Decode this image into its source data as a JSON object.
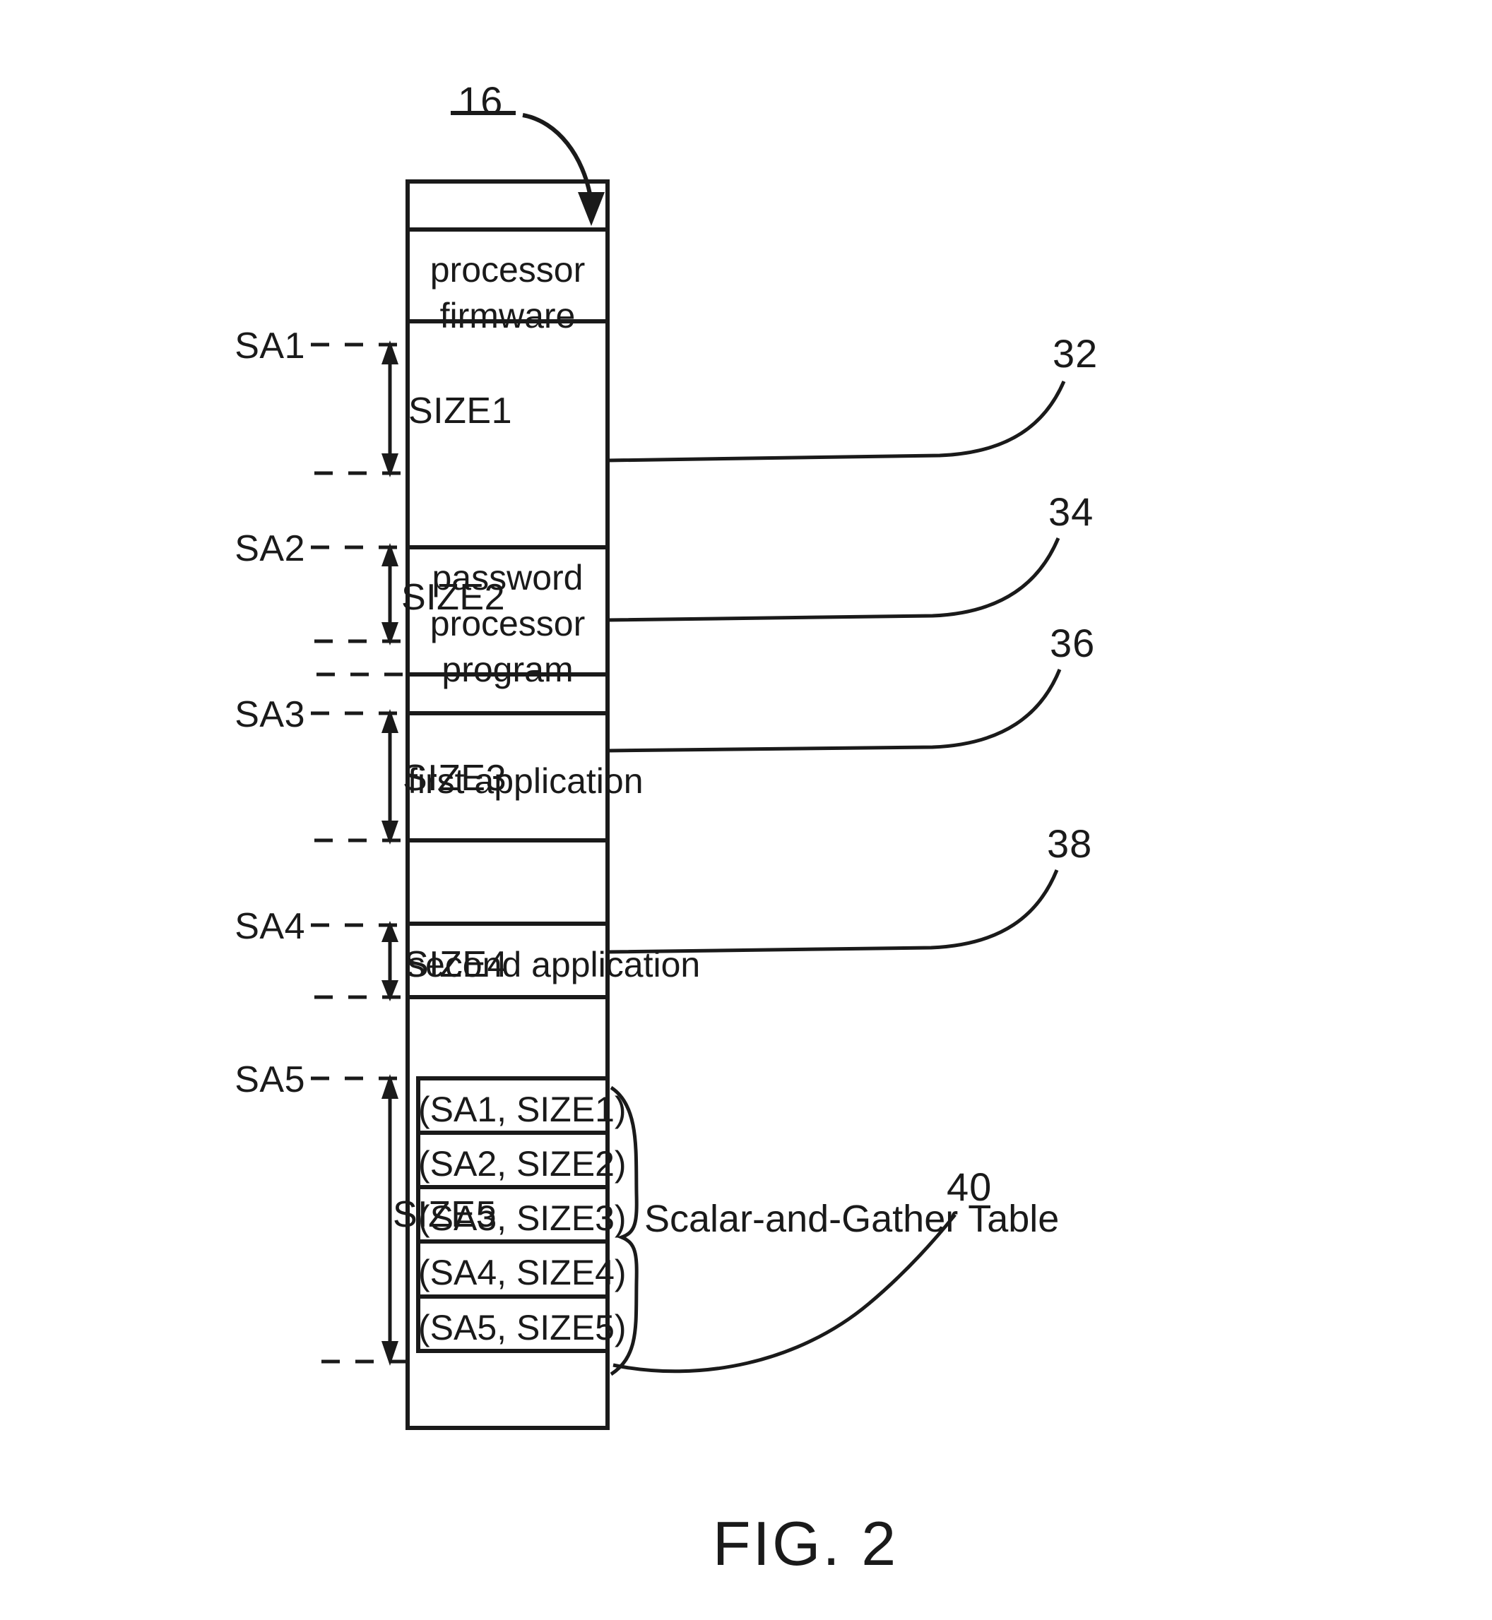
{
  "figure": {
    "caption": "FIG. 2",
    "top_reference": "16"
  },
  "memory_map": {
    "segments": [
      {
        "id": "processor-firmware",
        "text": "processor\nfirmware",
        "reference": "32"
      },
      {
        "id": "password-processor-program",
        "text": "password\nprocessor\nprogram",
        "reference": "34"
      },
      {
        "id": "first-application",
        "text": "first application",
        "reference": "36"
      },
      {
        "id": "second-application",
        "text": "second application",
        "reference": "38"
      }
    ],
    "segment_labels": {
      "processor_firmware_line1": "processor",
      "processor_firmware_line2": "firmware",
      "password_line1": "password",
      "password_line2": "processor",
      "password_line3": "program",
      "first_application": "first application",
      "second_application": "second application"
    },
    "references": {
      "processor_firmware": "32",
      "password_processor_program": "34",
      "first_application": "36",
      "second_application": "38",
      "table": "40"
    }
  },
  "start_addresses": {
    "sa1": "SA1",
    "sa2": "SA2",
    "sa3": "SA3",
    "sa4": "SA4",
    "sa5": "SA5"
  },
  "sizes": {
    "size1": "SIZE1",
    "size2": "SIZE2",
    "size3": "SIZE3",
    "size4": "SIZE4",
    "size5": "SIZE5"
  },
  "scalar_and_gather_table": {
    "title": "Scalar-and-Gather Table",
    "reference": "40",
    "entries": [
      "(SA1, SIZE1)",
      "(SA2, SIZE2)",
      "(SA3, SIZE3)",
      "(SA4, SIZE4)",
      "(SA5, SIZE5)"
    ]
  },
  "colors": {
    "ink": "#1a1a1a",
    "background": "#ffffff"
  }
}
